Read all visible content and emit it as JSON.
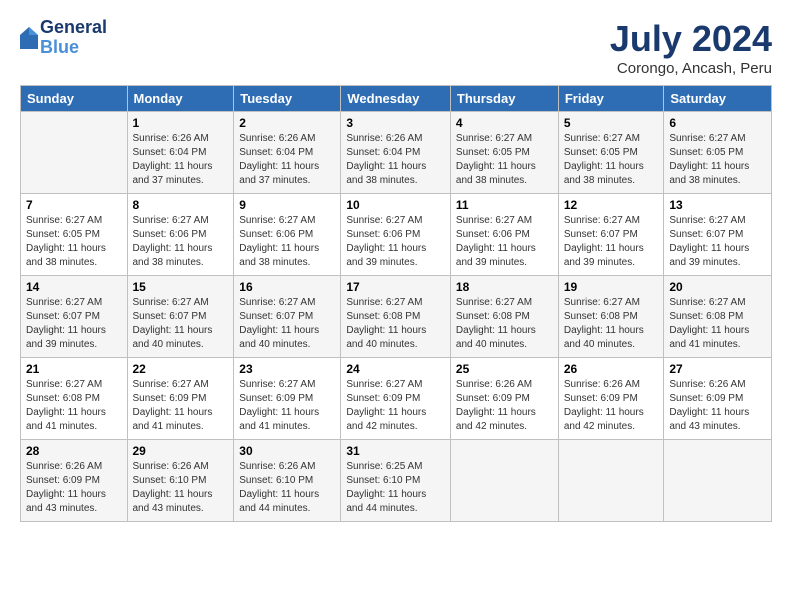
{
  "header": {
    "logo_line1": "General",
    "logo_line2": "Blue",
    "month_title": "July 2024",
    "location": "Corongo, Ancash, Peru"
  },
  "columns": [
    "Sunday",
    "Monday",
    "Tuesday",
    "Wednesday",
    "Thursday",
    "Friday",
    "Saturday"
  ],
  "weeks": [
    [
      {
        "day": "",
        "info": ""
      },
      {
        "day": "1",
        "info": "Sunrise: 6:26 AM\nSunset: 6:04 PM\nDaylight: 11 hours\nand 37 minutes."
      },
      {
        "day": "2",
        "info": "Sunrise: 6:26 AM\nSunset: 6:04 PM\nDaylight: 11 hours\nand 37 minutes."
      },
      {
        "day": "3",
        "info": "Sunrise: 6:26 AM\nSunset: 6:04 PM\nDaylight: 11 hours\nand 38 minutes."
      },
      {
        "day": "4",
        "info": "Sunrise: 6:27 AM\nSunset: 6:05 PM\nDaylight: 11 hours\nand 38 minutes."
      },
      {
        "day": "5",
        "info": "Sunrise: 6:27 AM\nSunset: 6:05 PM\nDaylight: 11 hours\nand 38 minutes."
      },
      {
        "day": "6",
        "info": "Sunrise: 6:27 AM\nSunset: 6:05 PM\nDaylight: 11 hours\nand 38 minutes."
      }
    ],
    [
      {
        "day": "7",
        "info": "Sunrise: 6:27 AM\nSunset: 6:05 PM\nDaylight: 11 hours\nand 38 minutes."
      },
      {
        "day": "8",
        "info": "Sunrise: 6:27 AM\nSunset: 6:06 PM\nDaylight: 11 hours\nand 38 minutes."
      },
      {
        "day": "9",
        "info": "Sunrise: 6:27 AM\nSunset: 6:06 PM\nDaylight: 11 hours\nand 38 minutes."
      },
      {
        "day": "10",
        "info": "Sunrise: 6:27 AM\nSunset: 6:06 PM\nDaylight: 11 hours\nand 39 minutes."
      },
      {
        "day": "11",
        "info": "Sunrise: 6:27 AM\nSunset: 6:06 PM\nDaylight: 11 hours\nand 39 minutes."
      },
      {
        "day": "12",
        "info": "Sunrise: 6:27 AM\nSunset: 6:07 PM\nDaylight: 11 hours\nand 39 minutes."
      },
      {
        "day": "13",
        "info": "Sunrise: 6:27 AM\nSunset: 6:07 PM\nDaylight: 11 hours\nand 39 minutes."
      }
    ],
    [
      {
        "day": "14",
        "info": "Sunrise: 6:27 AM\nSunset: 6:07 PM\nDaylight: 11 hours\nand 39 minutes."
      },
      {
        "day": "15",
        "info": "Sunrise: 6:27 AM\nSunset: 6:07 PM\nDaylight: 11 hours\nand 40 minutes."
      },
      {
        "day": "16",
        "info": "Sunrise: 6:27 AM\nSunset: 6:07 PM\nDaylight: 11 hours\nand 40 minutes."
      },
      {
        "day": "17",
        "info": "Sunrise: 6:27 AM\nSunset: 6:08 PM\nDaylight: 11 hours\nand 40 minutes."
      },
      {
        "day": "18",
        "info": "Sunrise: 6:27 AM\nSunset: 6:08 PM\nDaylight: 11 hours\nand 40 minutes."
      },
      {
        "day": "19",
        "info": "Sunrise: 6:27 AM\nSunset: 6:08 PM\nDaylight: 11 hours\nand 40 minutes."
      },
      {
        "day": "20",
        "info": "Sunrise: 6:27 AM\nSunset: 6:08 PM\nDaylight: 11 hours\nand 41 minutes."
      }
    ],
    [
      {
        "day": "21",
        "info": "Sunrise: 6:27 AM\nSunset: 6:08 PM\nDaylight: 11 hours\nand 41 minutes."
      },
      {
        "day": "22",
        "info": "Sunrise: 6:27 AM\nSunset: 6:09 PM\nDaylight: 11 hours\nand 41 minutes."
      },
      {
        "day": "23",
        "info": "Sunrise: 6:27 AM\nSunset: 6:09 PM\nDaylight: 11 hours\nand 41 minutes."
      },
      {
        "day": "24",
        "info": "Sunrise: 6:27 AM\nSunset: 6:09 PM\nDaylight: 11 hours\nand 42 minutes."
      },
      {
        "day": "25",
        "info": "Sunrise: 6:26 AM\nSunset: 6:09 PM\nDaylight: 11 hours\nand 42 minutes."
      },
      {
        "day": "26",
        "info": "Sunrise: 6:26 AM\nSunset: 6:09 PM\nDaylight: 11 hours\nand 42 minutes."
      },
      {
        "day": "27",
        "info": "Sunrise: 6:26 AM\nSunset: 6:09 PM\nDaylight: 11 hours\nand 43 minutes."
      }
    ],
    [
      {
        "day": "28",
        "info": "Sunrise: 6:26 AM\nSunset: 6:09 PM\nDaylight: 11 hours\nand 43 minutes."
      },
      {
        "day": "29",
        "info": "Sunrise: 6:26 AM\nSunset: 6:10 PM\nDaylight: 11 hours\nand 43 minutes."
      },
      {
        "day": "30",
        "info": "Sunrise: 6:26 AM\nSunset: 6:10 PM\nDaylight: 11 hours\nand 44 minutes."
      },
      {
        "day": "31",
        "info": "Sunrise: 6:25 AM\nSunset: 6:10 PM\nDaylight: 11 hours\nand 44 minutes."
      },
      {
        "day": "",
        "info": ""
      },
      {
        "day": "",
        "info": ""
      },
      {
        "day": "",
        "info": ""
      }
    ]
  ]
}
